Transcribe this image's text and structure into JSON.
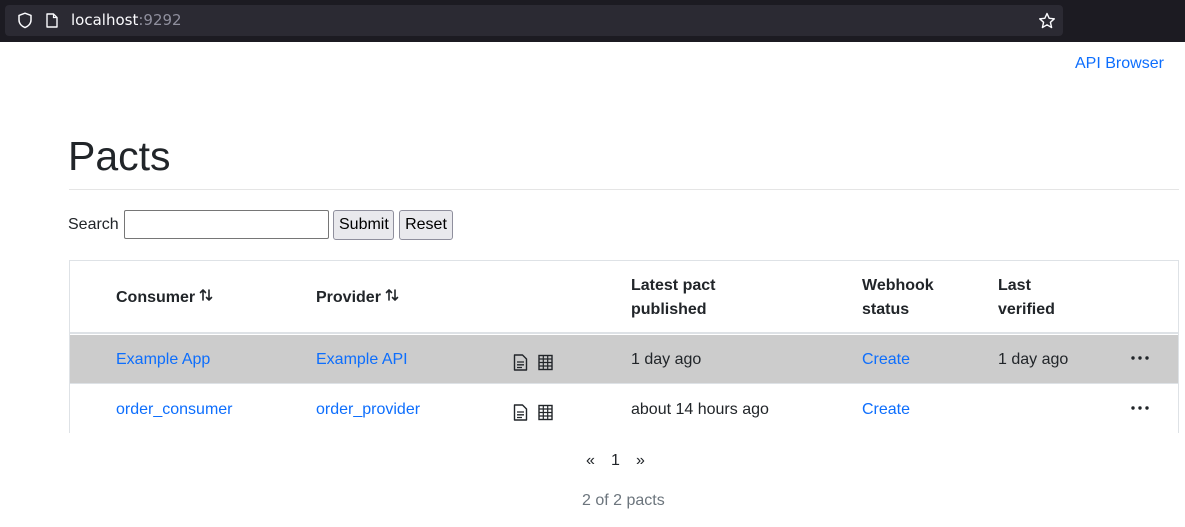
{
  "browser": {
    "url_host": "localhost",
    "url_port": ":9292",
    "icons": [
      "shield-icon",
      "page-icon",
      "bookmark-star-icon"
    ]
  },
  "header": {
    "api_browser_link": "API Browser"
  },
  "main": {
    "title": "Pacts",
    "search": {
      "label": "Search",
      "value": "",
      "submit_label": "Submit",
      "reset_label": "Reset"
    },
    "table": {
      "columns": {
        "consumer": "Consumer",
        "provider": "Provider",
        "latest_line1": "Latest pact",
        "latest_line2": "published",
        "webhook_line1": "Webhook",
        "webhook_line2": "status",
        "verified_line1": "Last",
        "verified_line2": "verified"
      },
      "rows": [
        {
          "consumer": "Example App",
          "provider": "Example API",
          "latest_pact_published": "1 day ago",
          "webhook_status": "Create",
          "last_verified": "1 day ago",
          "highlighted": true
        },
        {
          "consumer": "order_consumer",
          "provider": "order_provider",
          "latest_pact_published": "about 14 hours ago",
          "webhook_status": "Create",
          "last_verified": "",
          "highlighted": false
        }
      ]
    },
    "pagination": {
      "prev": "«",
      "current_page": "1",
      "next": "»"
    },
    "count_text": "2 of 2 pacts"
  },
  "colors": {
    "link": "#0d6efd",
    "highlight_row": "#cccccc",
    "chrome_bg": "#1c1b22"
  }
}
